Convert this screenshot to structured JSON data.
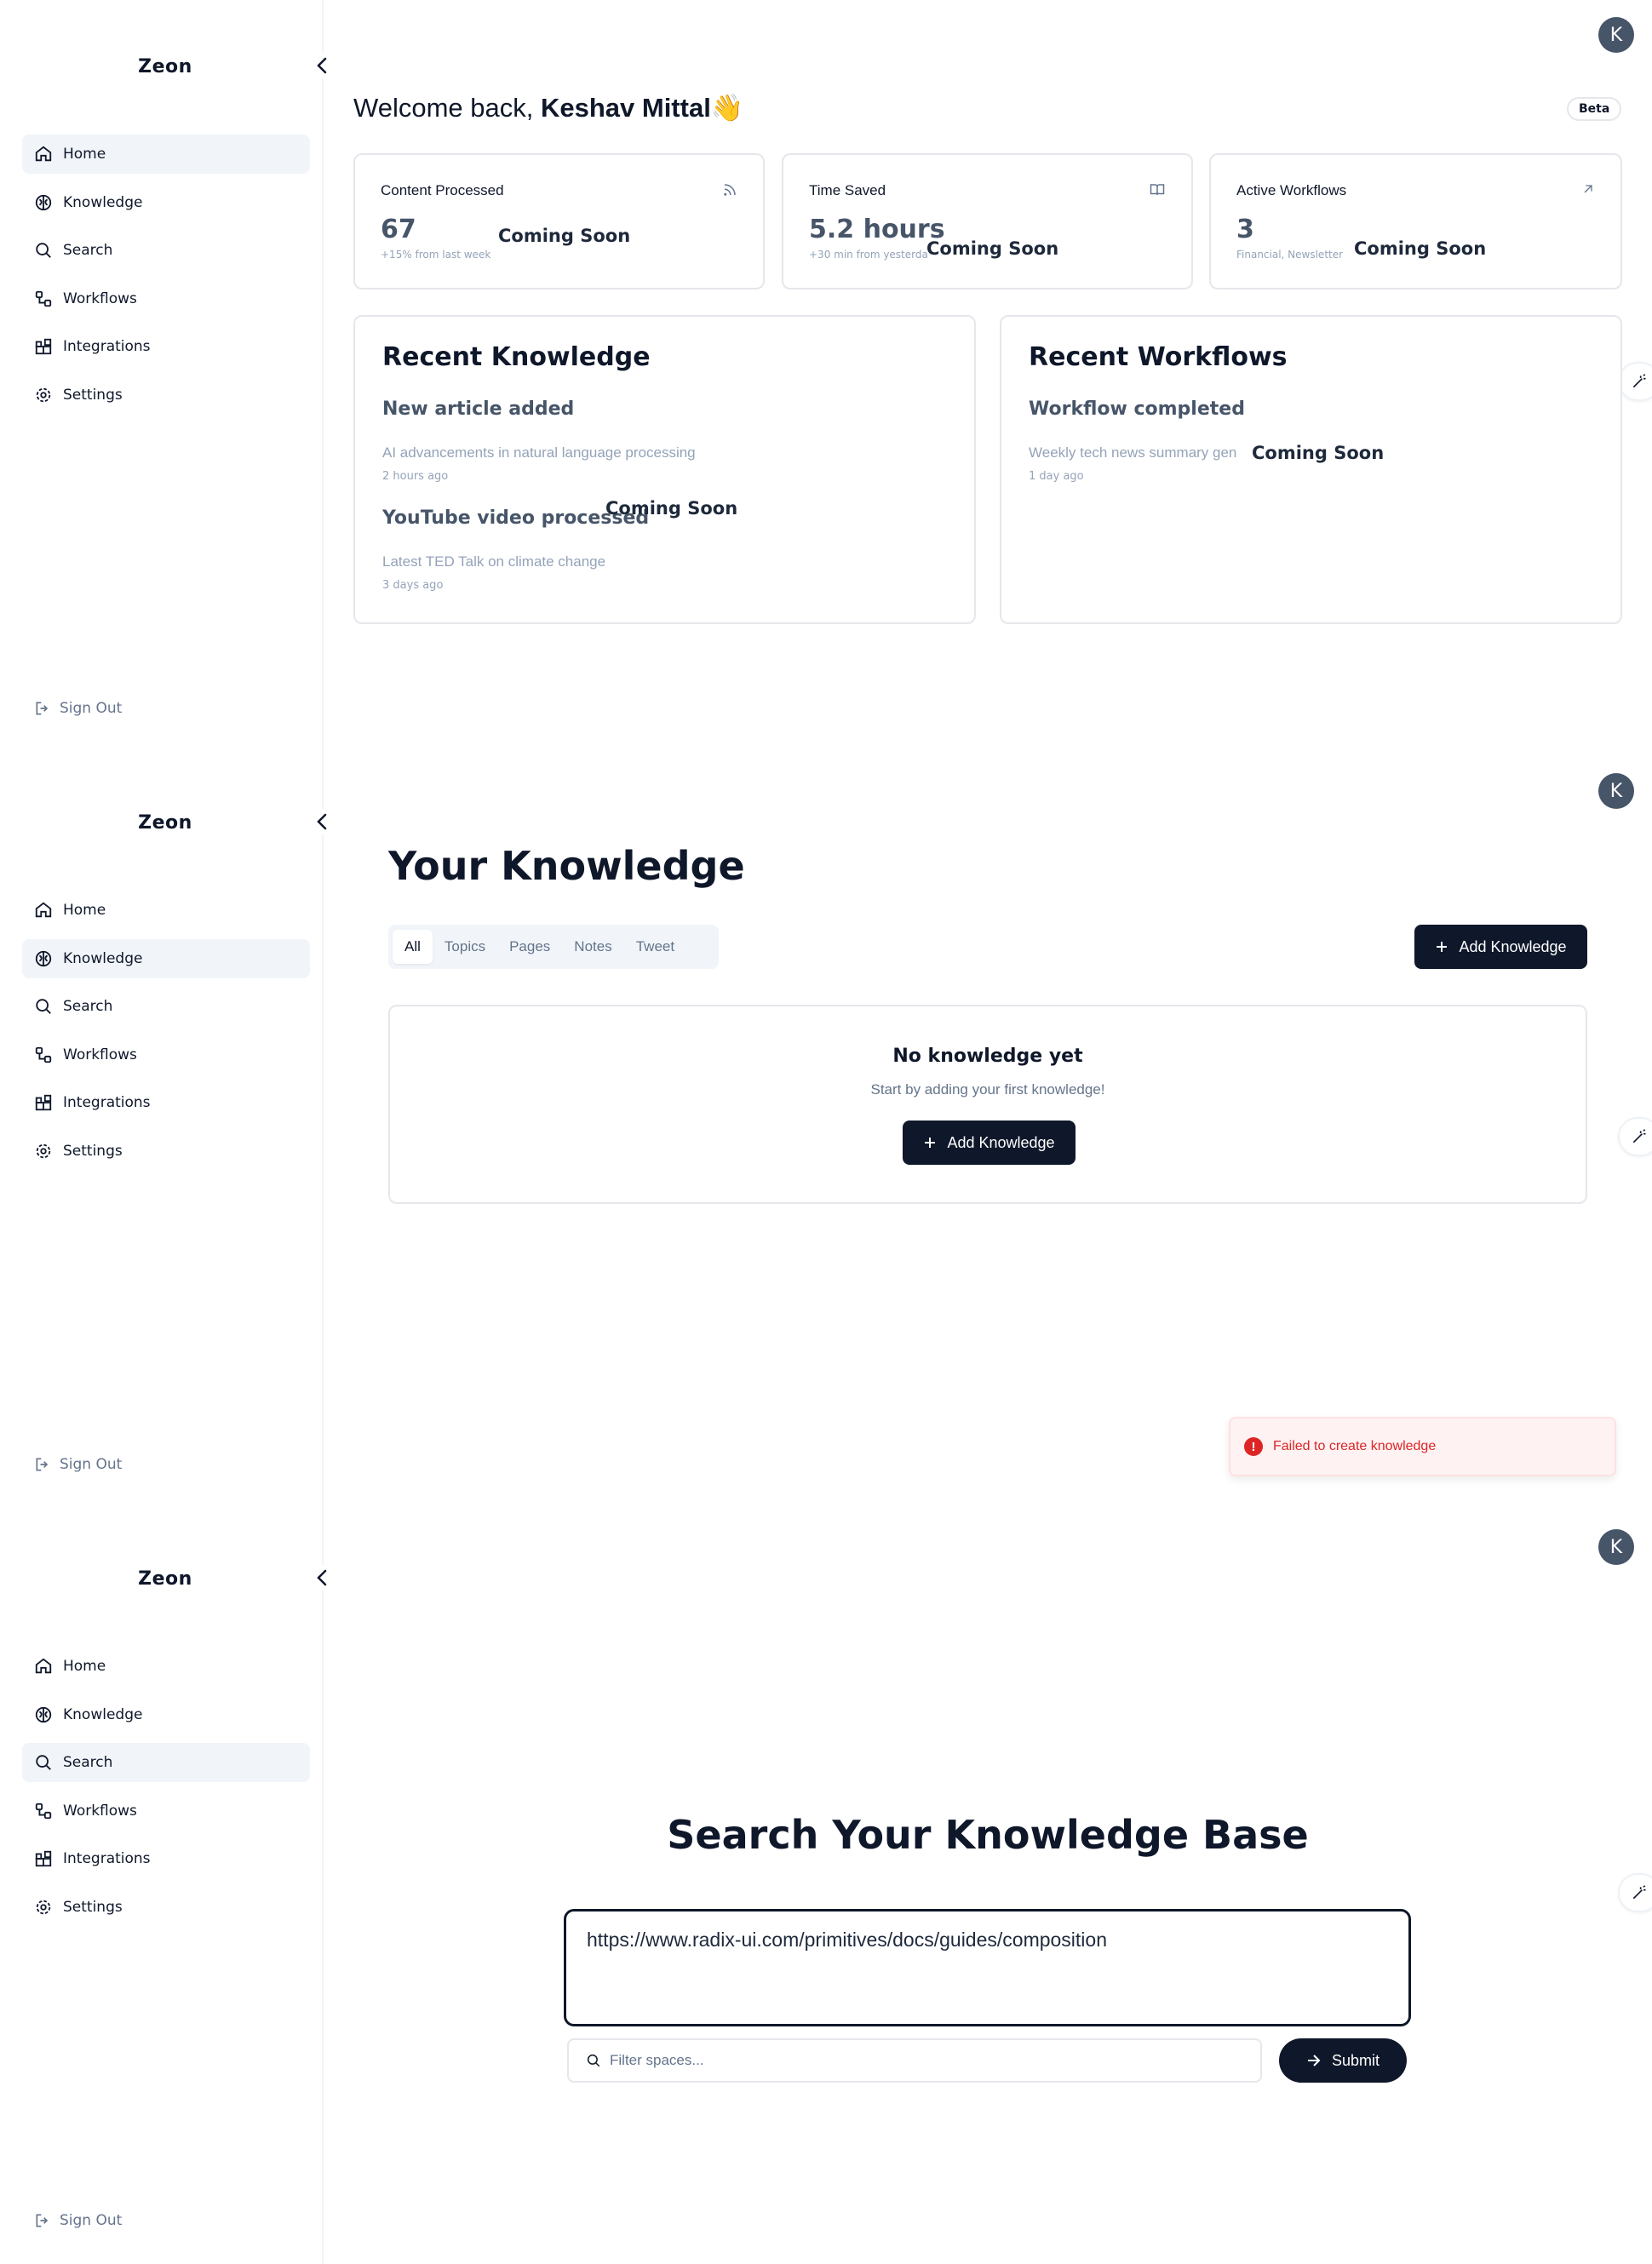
{
  "app": {
    "brand": "Zeon",
    "avatar_initial": "K"
  },
  "nav": {
    "items": [
      {
        "label": "Home",
        "icon": "home-icon"
      },
      {
        "label": "Knowledge",
        "icon": "brain-icon"
      },
      {
        "label": "Search",
        "icon": "search-icon"
      },
      {
        "label": "Workflows",
        "icon": "workflow-icon"
      },
      {
        "label": "Integrations",
        "icon": "blocks-icon"
      },
      {
        "label": "Settings",
        "icon": "settings-icon"
      }
    ],
    "sign_out": "Sign Out"
  },
  "home": {
    "welcome_prefix": "Welcome back,",
    "user_name": "Keshav Mittal",
    "wave": "👋",
    "beta": "Beta",
    "coming_soon": "Coming Soon",
    "stats": [
      {
        "title": "Content Processed",
        "value": "67",
        "sub": "+15% from last week",
        "icon": "rss-icon"
      },
      {
        "title": "Time Saved",
        "value": "5.2 hours",
        "sub": "+30 min from yesterday",
        "icon": "book-icon"
      },
      {
        "title": "Active Workflows",
        "value": "3",
        "sub": "Financial, Newsletter",
        "icon": "arrow-up-right-icon"
      }
    ],
    "recent_knowledge": {
      "title": "Recent Knowledge",
      "items": [
        {
          "title": "New article added",
          "desc": "AI advancements in natural language processing",
          "time": "2 hours ago"
        },
        {
          "title": "YouTube video processed",
          "desc": "Latest TED Talk on climate change",
          "time": "3 days ago"
        }
      ]
    },
    "recent_workflows": {
      "title": "Recent Workflows",
      "items": [
        {
          "title": "Workflow completed",
          "desc": "Weekly tech news summary gen",
          "time": "1 day ago"
        }
      ]
    }
  },
  "knowledge": {
    "title": "Your Knowledge",
    "tabs": [
      "All",
      "Topics",
      "Pages",
      "Notes",
      "Tweet"
    ],
    "add_button": "Add Knowledge",
    "empty_title": "No knowledge yet",
    "empty_sub": "Start by adding your first knowledge!",
    "toast": "Failed to create knowledge"
  },
  "search": {
    "title": "Search Your Knowledge Base",
    "query": "https://www.radix-ui.com/primitives/docs/guides/composition",
    "filter_placeholder": "Filter spaces...",
    "submit": "Submit"
  },
  "colors": {
    "primary": "#0f172a",
    "active_nav": "#f1f5f9",
    "error": "#dc2626",
    "muted": "#94a3b8"
  }
}
